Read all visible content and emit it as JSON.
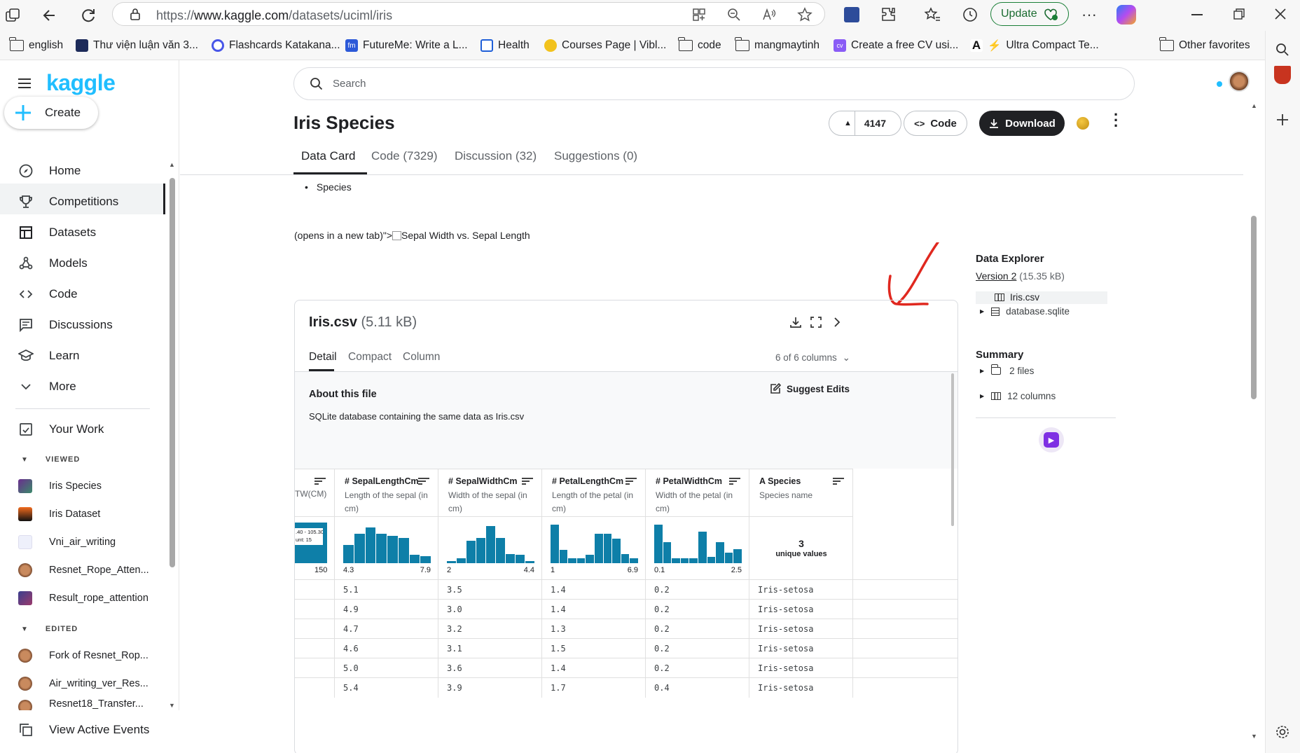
{
  "browser": {
    "url_prefix": "https://",
    "url_host": "www.kaggle.com",
    "url_path": "/datasets/uciml/iris",
    "update_label": "Update",
    "window_controls": [
      "minimize-icon",
      "restore-icon",
      "close-icon"
    ]
  },
  "bookmarks": [
    {
      "label": "english",
      "icon": "folder-icon"
    },
    {
      "label": "Thư viện luận văn 3...",
      "icon": "site-icon"
    },
    {
      "label": "Flashcards Katakana...",
      "icon": "site-icon"
    },
    {
      "label": "FutureMe: Write a L...",
      "icon": "site-icon"
    },
    {
      "label": "Health",
      "icon": "site-icon"
    },
    {
      "label": "Courses Page | Vibl...",
      "icon": "site-icon"
    },
    {
      "label": "code",
      "icon": "folder-icon"
    },
    {
      "label": "mangmaytinh",
      "icon": "folder-icon"
    },
    {
      "label": "Create a free CV usi...",
      "icon": "site-icon"
    },
    {
      "label": "Ultra Compact Te...",
      "icon": "site-icon"
    },
    {
      "label": "Other favorites",
      "icon": "folder-icon"
    }
  ],
  "kaggle": {
    "logo": "kaggle",
    "create_label": "Create",
    "nav": [
      "Home",
      "Competitions",
      "Datasets",
      "Models",
      "Code",
      "Discussions",
      "Learn",
      "More"
    ],
    "your_work": "Your Work",
    "viewed_label": "VIEWED",
    "viewed": [
      "Iris Species",
      "Iris Dataset",
      "Vni_air_writing",
      "Resnet_Rope_Atten...",
      "Result_rope_attention"
    ],
    "edited_label": "EDITED",
    "edited": [
      "Fork of Resnet_Rop...",
      "Air_writing_ver_Res...",
      "Resnet18_Transfer..."
    ],
    "view_active_events": "View Active Events"
  },
  "page": {
    "search_placeholder": "Search",
    "title": "Iris Species",
    "vote_count": "4147",
    "code_btn": "Code",
    "download_btn": "Download",
    "tabs": [
      "Data Card",
      "Code (7329)",
      "Discussion (32)",
      "Suggestions (0)"
    ],
    "bullet": "Species",
    "broken_text": "(opens in a new tab)\">",
    "broken_img_alt": "Sepal Width vs. Sepal Length"
  },
  "file_card": {
    "name": "Iris.csv",
    "size": "(5.11 kB)",
    "tabs": [
      "Detail",
      "Compact",
      "Column"
    ],
    "columns_info": "6 of 6 columns",
    "about_title": "About this file",
    "suggest_edits": "Suggest Edits",
    "about_text": "SQLite database containing the same data as Iris.csv",
    "partial_column": {
      "name": "TW(CM)",
      "tooltip_range": ".40 - 105.30",
      "tooltip_count": "unt: 15",
      "max": "150"
    },
    "columns": [
      {
        "name": "SepalLengthCm",
        "type_icon": "#",
        "desc": "Length of the sepal (in cm)",
        "min": "4.3",
        "max": "7.9",
        "hist": [
          0.45,
          0.72,
          0.88,
          0.72,
          0.68,
          0.62,
          0.2,
          0.18
        ]
      },
      {
        "name": "SepalWidthCm",
        "type_icon": "#",
        "desc": "Width of the sepal (in cm)",
        "min": "2",
        "max": "4.4",
        "hist": [
          0.06,
          0.12,
          0.55,
          0.62,
          0.92,
          0.62,
          0.22,
          0.2,
          0.06
        ]
      },
      {
        "name": "PetalLengthCm",
        "type_icon": "#",
        "desc": "Length of the petal (in cm)",
        "min": "1",
        "max": "6.9",
        "hist": [
          0.95,
          0.32,
          0.12,
          0.12,
          0.2,
          0.72,
          0.72,
          0.6,
          0.22,
          0.12
        ]
      },
      {
        "name": "PetalWidthCm",
        "type_icon": "#",
        "desc": "Width of the petal (in cm)",
        "min": "0.1",
        "max": "2.5",
        "hist": [
          0.95,
          0.52,
          0.12,
          0.12,
          0.12,
          0.78,
          0.15,
          0.52,
          0.25,
          0.35
        ]
      },
      {
        "name": "Species",
        "type_icon": "A",
        "desc": "Species name",
        "unique_count": "3",
        "unique_label": "unique values"
      }
    ],
    "rows": [
      [
        "5.1",
        "3.5",
        "1.4",
        "0.2",
        "Iris-setosa"
      ],
      [
        "4.9",
        "3.0",
        "1.4",
        "0.2",
        "Iris-setosa"
      ],
      [
        "4.7",
        "3.2",
        "1.3",
        "0.2",
        "Iris-setosa"
      ],
      [
        "4.6",
        "3.1",
        "1.5",
        "0.2",
        "Iris-setosa"
      ],
      [
        "5.0",
        "3.6",
        "1.4",
        "0.2",
        "Iris-setosa"
      ],
      [
        "5.4",
        "3.9",
        "1.7",
        "0.4",
        "Iris-setosa"
      ]
    ]
  },
  "data_explorer": {
    "title": "Data Explorer",
    "version_link": "Version 2",
    "version_size": "(15.35 kB)",
    "files": [
      "Iris.csv",
      "database.sqlite"
    ],
    "summary_title": "Summary",
    "summary_items": [
      "2 files",
      "12 columns"
    ]
  },
  "colors": {
    "kaggle_blue": "#20beff",
    "hist_bar": "#0e7fa8",
    "annotation": "#e0281f"
  }
}
